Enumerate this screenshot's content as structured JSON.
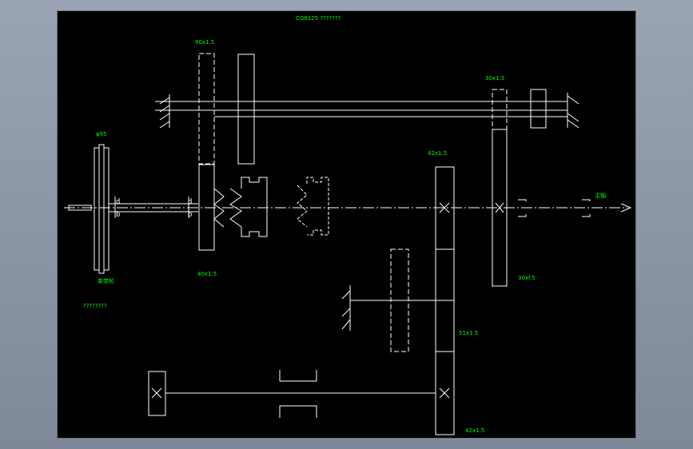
{
  "drawing": {
    "title": "CG6125 ???????",
    "background_color": "#000000",
    "line_color": "#ffffff",
    "text_color": "#00ff00"
  },
  "labels": {
    "gear_top_left": "90x1.5",
    "gear_top_right": "30x1.5",
    "pulley_size": "φ95",
    "pulley_name": "单带轮",
    "pulley_note": "????????",
    "gear_mid_left": "40x1.5",
    "gear_big": "42x1.5",
    "gear_right_lower": "30xf.5",
    "gear_mid_lower": "51x1.5",
    "gear_bottom": "42x1.5",
    "spindle": "主轴"
  }
}
